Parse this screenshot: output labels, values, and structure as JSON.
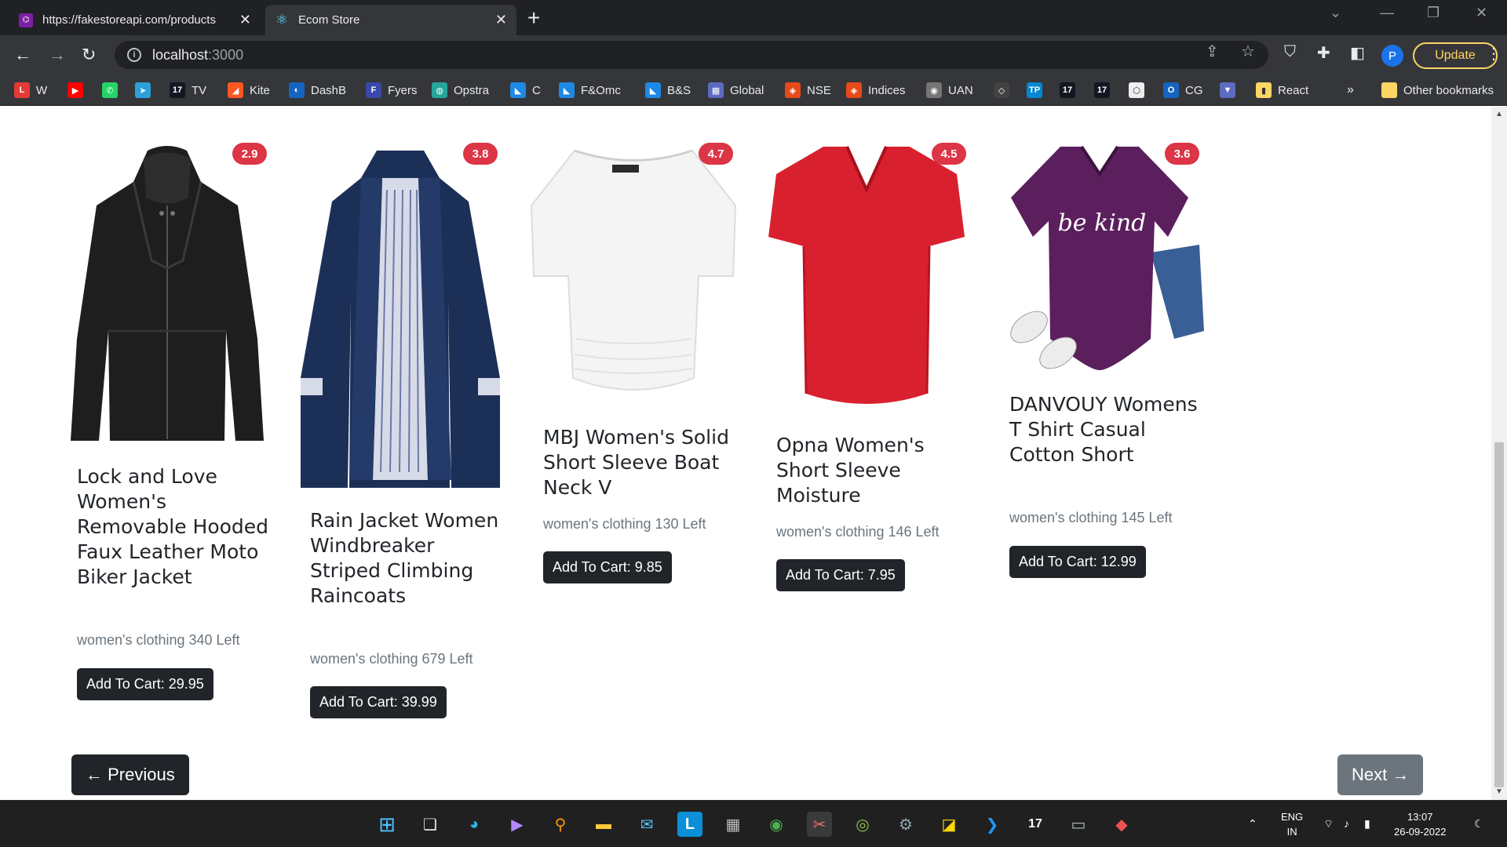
{
  "browser": {
    "tabs": [
      {
        "title": "https://fakestoreapi.com/products"
      },
      {
        "title": "Ecom Store"
      }
    ],
    "address": {
      "host": "localhost",
      "port": ":3000"
    },
    "update_label": "Update",
    "profile_initial": "P",
    "bookmarks": [
      {
        "label": "W",
        "icon": "L",
        "color": "#e53935"
      },
      {
        "label": "",
        "icon": "▶",
        "color": "#ff0000"
      },
      {
        "label": "",
        "icon": "✆",
        "color": "#25d366"
      },
      {
        "label": "",
        "icon": "➤",
        "color": "#2aa1da"
      },
      {
        "label": "TV",
        "icon": "17",
        "color": "#131722"
      },
      {
        "label": "Kite",
        "icon": "◢",
        "color": "#ff5722"
      },
      {
        "label": "DashB",
        "icon": "◐",
        "color": "#1565c0"
      },
      {
        "label": "Fyers",
        "icon": "F",
        "color": "#3949ab"
      },
      {
        "label": "Opstra",
        "icon": "◍",
        "color": "#26a69a"
      },
      {
        "label": "C",
        "icon": "◣",
        "color": "#1e88e5"
      },
      {
        "label": "F&Omc",
        "icon": "◣",
        "color": "#1e88e5"
      },
      {
        "label": "B&S",
        "icon": "◣",
        "color": "#1e88e5"
      },
      {
        "label": "Global",
        "icon": "▦",
        "color": "#5c6bc0"
      },
      {
        "label": "NSE",
        "icon": "◈",
        "color": "#e64a19"
      },
      {
        "label": "Indices",
        "icon": "◈",
        "color": "#e64a19"
      },
      {
        "label": "UAN",
        "icon": "◉",
        "color": "#757575"
      },
      {
        "label": "",
        "icon": "◇",
        "color": "#424242"
      },
      {
        "label": "",
        "icon": "TP",
        "color": "#0288d1"
      },
      {
        "label": "",
        "icon": "17",
        "color": "#131722"
      },
      {
        "label": "",
        "icon": "17",
        "color": "#131722"
      },
      {
        "label": "",
        "icon": "⬡",
        "color": "#eeeeee"
      },
      {
        "label": "CG",
        "icon": "O",
        "color": "#1565c0"
      },
      {
        "label": "",
        "icon": "▼",
        "color": "#5c6bc0"
      },
      {
        "label": "React",
        "icon": "▮",
        "color": "#fdd663"
      }
    ],
    "bookmarks_overflow": "»",
    "other_bookmarks": "Other bookmarks"
  },
  "products": [
    {
      "title": "Lock and Love Women's Removable Hooded Faux Leather Moto Biker Jacket",
      "rating": "2.9",
      "meta": "women's clothing 340 Left",
      "button": "Add To Cart: 29.95",
      "image": "black-leather-jacket"
    },
    {
      "title": "Rain Jacket Women Windbreaker Striped Climbing Raincoats",
      "rating": "3.8",
      "meta": "women's clothing 679 Left",
      "button": "Add To Cart: 39.99",
      "image": "navy-rain-jacket"
    },
    {
      "title": "MBJ Women's Solid Short Sleeve Boat Neck V",
      "rating": "4.7",
      "meta": "women's clothing 130 Left",
      "button": "Add To Cart: 9.85",
      "image": "white-boat-neck-top"
    },
    {
      "title": "Opna Women's Short Sleeve Moisture",
      "rating": "4.5",
      "meta": "women's clothing 146 Left",
      "button": "Add To Cart: 7.95",
      "image": "red-v-neck-tshirt"
    },
    {
      "title": "DANVOUY Womens T Shirt Casual Cotton Short",
      "rating": "3.6",
      "meta": "women's clothing 145 Left",
      "button": "Add To Cart: 12.99",
      "image": "purple-be-kind-tshirt",
      "print": "be kind"
    }
  ],
  "pagination": {
    "previous": "← Previous",
    "next": "Next →"
  },
  "taskbar": {
    "lang_top": "ENG",
    "lang_bottom": "IN",
    "time": "13:07",
    "date": "26-09-2022"
  }
}
